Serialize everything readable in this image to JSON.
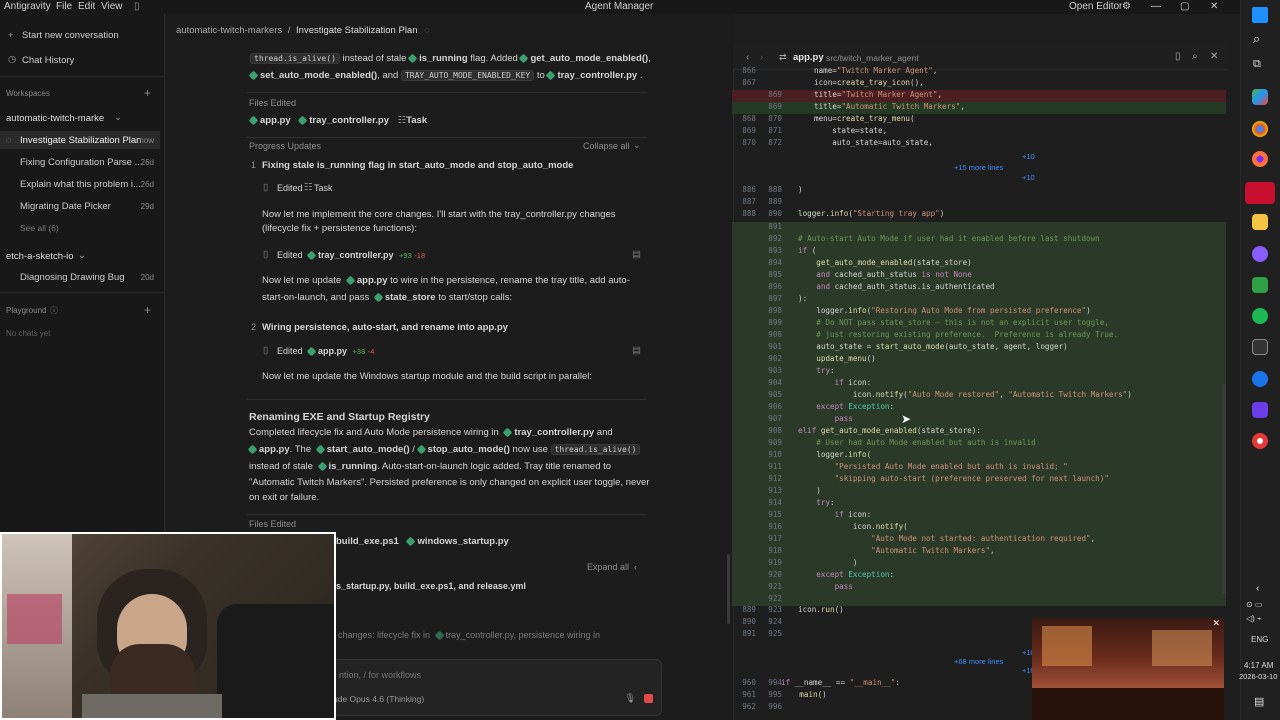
{
  "titlebar": {
    "app_name": "Antigravity",
    "menu": [
      "File",
      "Edit",
      "View"
    ],
    "center_title": "Agent Manager",
    "open_editor": "Open Editor"
  },
  "sidebar": {
    "new_conversation": "Start new conversation",
    "chat_history": "Chat History",
    "workspaces_label": "Workspaces",
    "workspace1": {
      "name": "automatic-twitch-marke",
      "items": [
        {
          "label": "Investigate Stabilization Plan",
          "date": "now"
        },
        {
          "label": "Fixing Configuration Parse ...",
          "date": "26d"
        },
        {
          "label": "Explain what this problem i...",
          "date": "26d"
        },
        {
          "label": "Migrating Date Picker",
          "date": "29d"
        }
      ],
      "see_all": "See all (6)"
    },
    "workspace2": {
      "name": "etch-a-sketch-io",
      "items": [
        {
          "label": "Diagnosing Drawing Bug",
          "date": "20d"
        }
      ]
    },
    "playground_label": "Playground",
    "no_chats": "No chats yet"
  },
  "agent": {
    "breadcrumb_ws": "automatic-twitch-markers",
    "breadcrumb_sep": "/",
    "breadcrumb_task": "Investigate Stabilization Plan",
    "top_line1": {
      "code1": "thread.is_alive()",
      "t1": "instead of stale",
      "var1": "is_running",
      "t2": "flag. Added",
      "fn1": "get_auto_mode_enabled()",
      "t3": ","
    },
    "top_line2": {
      "fn2": "set_auto_mode_enabled()",
      "t1": ", and",
      "code2": "TRAY_AUTO_MODE_ENABLED_KEY",
      "t2": "to",
      "file": "tray_controller.py",
      "t3": "."
    },
    "files_edited_label": "Files Edited",
    "files_edited_1": [
      "app.py",
      "tray_controller.py",
      "Task"
    ],
    "progress_label": "Progress Updates",
    "collapse_all": "Collapse all",
    "step1_num": "1",
    "step1_title": "Fixing stale is_running flag in start_auto_mode and stop_auto_mode",
    "edited_label": "Edited",
    "edited_task": "Task",
    "msg1": "Now let me implement the core changes. I'll start with the tray_controller.py changes",
    "msg1b": "(lifecycle fix + persistence functions):",
    "edit1_file": "tray_controller.py",
    "edit1_add": "+93",
    "edit1_del": "-18",
    "msg2_a": "Now let me update",
    "msg2_file": "app.py",
    "msg2_b": "to wire in the persistence, rename the tray title, add auto-",
    "msg2_c": "start-on-launch, and pass",
    "msg2_file2": "state_store",
    "msg2_d": "to start/stop calls:",
    "step2_num": "2",
    "step2_title": "Wiring persistence, auto-start, and rename into app.py",
    "edit2_file": "app.py",
    "edit2_add": "+38",
    "edit2_del": "-4",
    "msg3": "Now let me update the Windows startup module and the build script in parallel:",
    "section2_title": "Renaming EXE and Startup Registry",
    "s2_l1a": "Completed lifecycle fix and Auto Mode persistence wiring in",
    "s2_l1file": "tray_controller.py",
    "s2_l1b": "and",
    "s2_l2file": "app.py",
    "s2_l2a": ". The",
    "s2_l2fn1": "start_auto_mode()",
    "s2_l2sep": "/",
    "s2_l2fn2": "stop_auto_mode()",
    "s2_l2b": "now use",
    "s2_l2code": "thread.is_alive()",
    "s2_l3a": "instead of stale",
    "s2_l3var": "is_running",
    "s2_l3b": ". Auto-start-on-launch logic added. Tray title renamed to",
    "s2_l4": "\"Automatic Twitch Markers\". Persisted preference is only changed on explicit user toggle, never",
    "s2_l5": "on exit or failure.",
    "files_edited_2": [
      "build_exe.ps1",
      "windows_startup.py"
    ],
    "expand_all": "Expand all",
    "summary_files": "s_startup.py, build_exe.ps1, and release.yml",
    "bottom_msg_a": "changes: lifecycle fix in",
    "bottom_msg_file": "tray_controller.py",
    "bottom_msg_b": ", persistence wiring in",
    "input_placeholder": "ntion, / for workflows",
    "model": "ude Opus 4.6 (Thinking)"
  },
  "editor": {
    "file": "app.py",
    "path": "src/twitch_marker_agent",
    "more_15": "+15 more lines",
    "more_68": "+68 more lines",
    "expand_up": "+10",
    "expand_down": "+10",
    "lines": [
      {
        "a": "866",
        "b": "",
        "t": "name=\"Twitch Marker Agent\",",
        "k": "ctx"
      },
      {
        "a": "867",
        "b": "",
        "t": "icon=create_tray_icon(),",
        "k": "ctx"
      },
      {
        "a": "",
        "b": "869",
        "t": "title=\"Twitch Marker Agent\",",
        "k": "del"
      },
      {
        "a": "",
        "b": "869",
        "t": "title=\"Automatic Twitch Markers\",",
        "k": "add"
      },
      {
        "a": "868",
        "b": "870",
        "t": "menu=create_tray_menu(",
        "k": "ctx"
      },
      {
        "a": "869",
        "b": "871",
        "t": "    state=state,",
        "k": "ctx"
      },
      {
        "a": "870",
        "b": "872",
        "t": "    auto_state=auto_state,",
        "k": "ctx"
      }
    ],
    "lines2": [
      {
        "a": "886",
        "b": "888",
        "t": ")"
      },
      {
        "a": "887",
        "b": "889",
        "t": ""
      },
      {
        "a": "888",
        "b": "890",
        "t": "logger.info(\"Starting tray app\")"
      }
    ],
    "block": [
      {
        "b": "891",
        "t": ""
      },
      {
        "b": "892",
        "t": "# Auto-start Auto Mode if user had it enabled before last shutdown"
      },
      {
        "b": "893",
        "t": "if ("
      },
      {
        "b": "894",
        "t": "    get_auto_mode_enabled(state_store)"
      },
      {
        "b": "895",
        "t": "    and cached_auth_status is not None"
      },
      {
        "b": "896",
        "t": "    and cached_auth_status.is_authenticated"
      },
      {
        "b": "897",
        "t": "):"
      },
      {
        "b": "898",
        "t": "    logger.info(\"Restoring Auto Mode from persisted preference\")"
      },
      {
        "b": "899",
        "t": "    # Do NOT pass state_store — this is not an explicit user toggle,"
      },
      {
        "b": "900",
        "t": "    # just restoring existing preference.  Preference is already True."
      },
      {
        "b": "901",
        "t": "    auto_state = start_auto_mode(auto_state, agent, logger)"
      },
      {
        "b": "902",
        "t": "    update_menu()"
      },
      {
        "b": "903",
        "t": "    try:"
      },
      {
        "b": "904",
        "t": "        if icon:"
      },
      {
        "b": "905",
        "t": "            icon.notify(\"Auto Mode restored\", \"Automatic Twitch Markers\")"
      },
      {
        "b": "906",
        "t": "    except Exception:"
      },
      {
        "b": "907",
        "t": "        pass"
      },
      {
        "b": "908",
        "t": "elif get_auto_mode_enabled(state_store):"
      },
      {
        "b": "909",
        "t": "    # User had Auto Mode enabled but auth is invalid"
      },
      {
        "b": "910",
        "t": "    logger.info("
      },
      {
        "b": "911",
        "t": "        \"Persisted Auto Mode enabled but auth is invalid; \""
      },
      {
        "b": "912",
        "t": "        \"skipping auto-start (preference preserved for next launch)\""
      },
      {
        "b": "913",
        "t": "    )"
      },
      {
        "b": "914",
        "t": "    try:"
      },
      {
        "b": "915",
        "t": "        if icon:"
      },
      {
        "b": "916",
        "t": "            icon.notify("
      },
      {
        "b": "917",
        "t": "                \"Auto Mode not started: authentication required\","
      },
      {
        "b": "918",
        "t": "                \"Automatic Twitch Markers\","
      },
      {
        "b": "919",
        "t": "            )"
      },
      {
        "b": "920",
        "t": "    except Exception:"
      },
      {
        "b": "921",
        "t": "        pass"
      },
      {
        "b": "922",
        "t": ""
      }
    ],
    "lines3": [
      {
        "a": "889",
        "b": "923",
        "t": "icon.run()"
      },
      {
        "a": "890",
        "b": "924",
        "t": ""
      },
      {
        "a": "891",
        "b": "925",
        "t": ""
      }
    ],
    "lines4": [
      {
        "a": "960",
        "b": "994",
        "t": "if __name__ == \"__main__\":"
      },
      {
        "a": "961",
        "b": "995",
        "t": "    main()"
      },
      {
        "a": "962",
        "b": "996",
        "t": ""
      }
    ]
  },
  "taskbar": {
    "time": "4:17 AM",
    "date": "2026-03-10",
    "lang": "ENG"
  },
  "colors": {
    "accent": "#3f8cff",
    "diff_del": "#4b1e21",
    "diff_add": "#243a24",
    "python_icon": "#3aa06e"
  }
}
